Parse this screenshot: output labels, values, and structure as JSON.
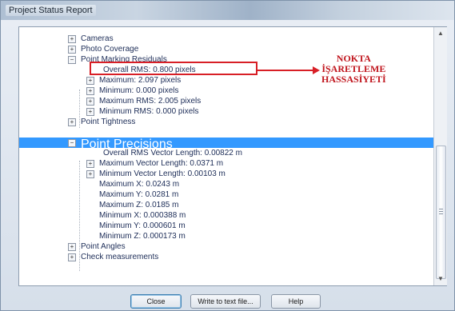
{
  "window": {
    "title": "Project Status Report"
  },
  "tree": [
    {
      "label": "Cameras",
      "level": 1,
      "expander": "+"
    },
    {
      "label": "Photo Coverage",
      "level": 1,
      "expander": ""
    },
    {
      "label": "Point Marking Residuals",
      "level": 1,
      "expander": "-"
    },
    {
      "label": "Overall RMS: 0.800 pixels",
      "level": 2,
      "expander": ""
    },
    {
      "label": "Maximum: 2.097 pixels",
      "level": 2,
      "expander": "+"
    },
    {
      "label": "Minimum: 0.000 pixels",
      "level": 2,
      "expander": "+"
    },
    {
      "label": "Maximum RMS: 2.005 pixels",
      "level": 2,
      "expander": "+"
    },
    {
      "label": "Minimum RMS: 0.000 pixels",
      "level": 2,
      "expander": "+"
    },
    {
      "label": "Point Tightness",
      "level": 1,
      "expander": "+"
    },
    {
      "label": "Point Precisions",
      "level": 1,
      "expander": "-"
    },
    {
      "label": "Overall RMS Vector Length: 0.00822 m",
      "level": 2,
      "expander": ""
    },
    {
      "label": "Maximum Vector Length: 0.0371 m",
      "level": 2,
      "expander": "+"
    },
    {
      "label": "Minimum Vector Length: 0.00103 m",
      "level": 2,
      "expander": "+"
    },
    {
      "label": "Maximum X: 0.0243 m",
      "level": 2,
      "expander": ""
    },
    {
      "label": "Maximum Y: 0.0281 m",
      "level": 2,
      "expander": ""
    },
    {
      "label": "Maximum Z: 0.0185 m",
      "level": 2,
      "expander": ""
    },
    {
      "label": "Minimum X: 0.000388 m",
      "level": 2,
      "expander": ""
    },
    {
      "label": "Minimum Y: 0.000601 m",
      "level": 2,
      "expander": ""
    },
    {
      "label": "Minimum Z: 0.000173 m",
      "level": 2,
      "expander": ""
    },
    {
      "label": "Point Angles",
      "level": 1,
      "expander": "+"
    },
    {
      "label": "Check measurements",
      "level": 1,
      "expander": "+"
    }
  ],
  "selected_item": "Point Precisions",
  "annotation": {
    "line1": "NOKTA",
    "line2": "İŞARETLEME",
    "line3": "HASSASİYETİ"
  },
  "buttons": {
    "close": "Close",
    "write": "Write to text file...",
    "help": "Help"
  },
  "colors": {
    "selection": "#3399ff",
    "annotation": "#d81f26",
    "tree_text": "#20305a"
  }
}
